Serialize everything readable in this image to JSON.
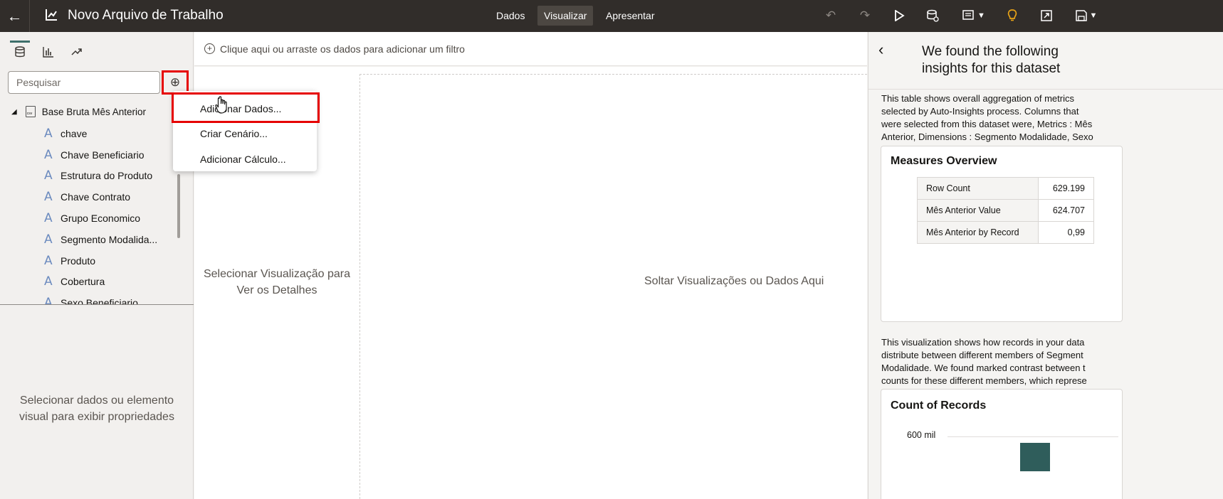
{
  "header": {
    "title": "Novo Arquivo de Trabalho",
    "tabs": [
      "Dados",
      "Visualizar",
      "Apresentar"
    ],
    "active_tab": "Visualizar",
    "icons": [
      "undo-icon",
      "redo-icon",
      "play-icon",
      "refresh-data-icon",
      "narrative-icon",
      "insights-lightbulb-icon",
      "export-icon",
      "save-icon"
    ]
  },
  "left_panel": {
    "search_placeholder": "Pesquisar",
    "dataset": "Base Bruta Mês Anterior",
    "columns": [
      "chave",
      "Chave Beneficiario",
      "Estrutura do Produto",
      "Chave Contrato",
      "Grupo Economico",
      "Segmento Modalida...",
      "Produto",
      "Cobertura",
      "Sexo Beneficiario"
    ],
    "properties_hint": "Selecionar dados ou elemento visual para exibir propriedades"
  },
  "add_menu": {
    "items": [
      "Adicionar Dados...",
      "Criar Cenário...",
      "Adicionar Cálculo..."
    ]
  },
  "canvas": {
    "filter_hint": "Clique aqui ou arraste os dados para adicionar um filtro",
    "select_viz": "Selecionar Visualização para Ver os Detalhes",
    "drop_hint": "Soltar Visualizações ou Dados Aqui"
  },
  "insights": {
    "title": "We found the following insights for this dataset",
    "intro_lines": [
      "This table shows overall aggregation of metrics",
      "selected by Auto-Insights process. Columns that",
      "were selected from this dataset were, Metrics : Mês",
      "Anterior, Dimensions : Segmento Modalidade, Sexo"
    ],
    "measures": {
      "title": "Measures Overview",
      "rows": [
        {
          "label": "Row Count",
          "value": "629.199"
        },
        {
          "label": "Mês Anterior Value",
          "value": "624.707"
        },
        {
          "label": "Mês Anterior by Record",
          "value": "0,99"
        }
      ]
    },
    "dist_lines": [
      "This visualization shows how records in your data",
      "distribute between different members of Segment",
      "Modalidade. We found marked contrast between t",
      "counts for these different members, which represe"
    ],
    "count_chart": {
      "title": "Count of Records",
      "axis_tick": "600 mil"
    }
  }
}
